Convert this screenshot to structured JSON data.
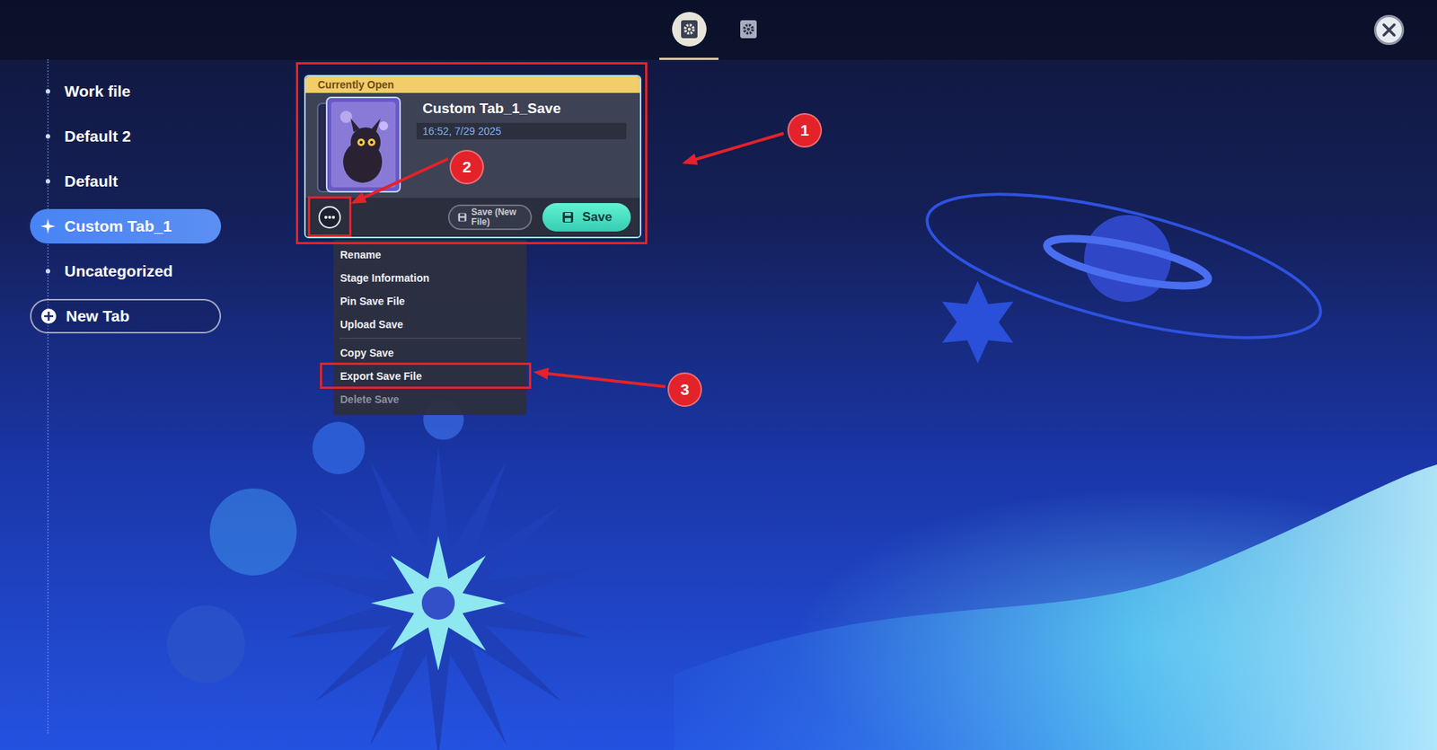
{
  "top_tabs": [
    {
      "selected": true
    },
    {
      "selected": false
    }
  ],
  "sidebar": {
    "items": [
      {
        "label": "Work file",
        "selected": false
      },
      {
        "label": "Default 2",
        "selected": false
      },
      {
        "label": "Default",
        "selected": false
      },
      {
        "label": "Custom Tab_1",
        "selected": true
      },
      {
        "label": "Uncategorized",
        "selected": false
      }
    ],
    "new_tab": "New Tab"
  },
  "save_card": {
    "badge": "Currently Open",
    "title": "Custom Tab_1_Save",
    "timestamp": "16:52, 7/29 2025",
    "menu_open": true,
    "highlighted": true,
    "buttons": [
      {
        "label": "Save (New File)",
        "kind": "secondary"
      },
      {
        "label": "Save",
        "kind": "primary"
      }
    ]
  },
  "context_menu": [
    {
      "label": "Rename",
      "disabled": false,
      "divider_after": false,
      "highlighted": false
    },
    {
      "label": "Stage Information",
      "disabled": false,
      "divider_after": false,
      "highlighted": false
    },
    {
      "label": "Pin Save File",
      "disabled": false,
      "divider_after": false,
      "highlighted": false
    },
    {
      "label": "Upload Save",
      "disabled": false,
      "divider_after": true,
      "highlighted": false
    },
    {
      "label": "Copy Save",
      "disabled": false,
      "divider_after": false,
      "highlighted": false
    },
    {
      "label": "Export Save File",
      "disabled": false,
      "divider_after": false,
      "highlighted": true
    },
    {
      "label": "Delete Save",
      "disabled": true,
      "divider_after": false,
      "highlighted": false
    }
  ],
  "annotations": [
    {
      "label": "1"
    },
    {
      "label": "2"
    },
    {
      "label": "3"
    }
  ]
}
